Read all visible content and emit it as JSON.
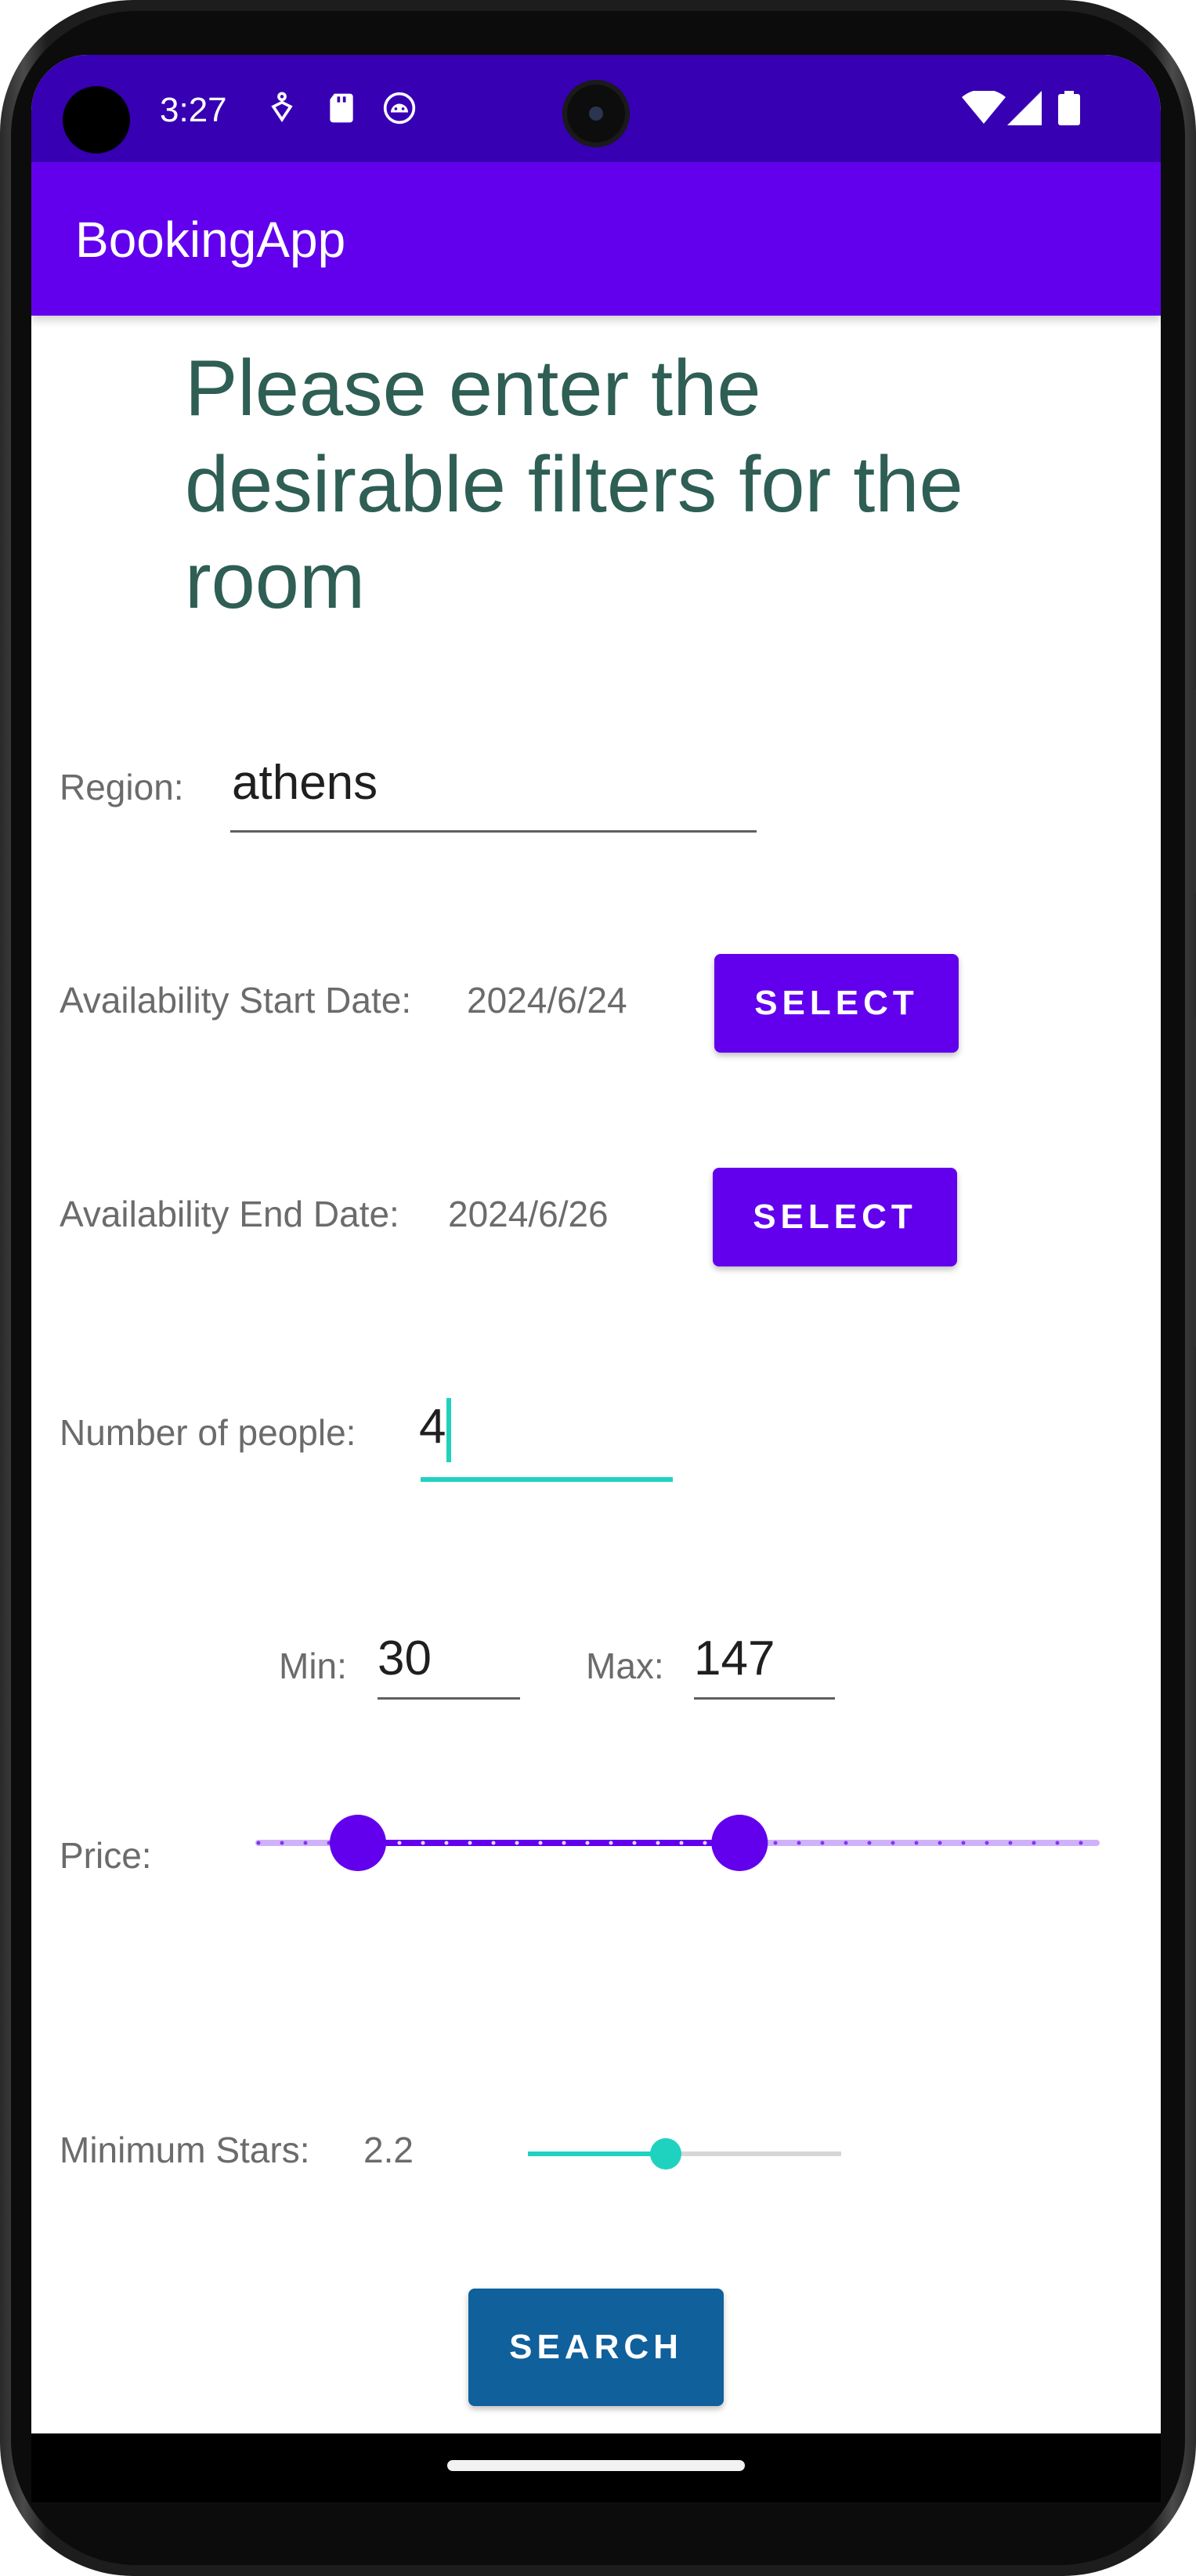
{
  "status_bar": {
    "time": "3:27",
    "left_icons": [
      "accessibility-icon",
      "sd-card-icon",
      "android-debug-icon"
    ],
    "right_icons": [
      "wifi-icon",
      "cell-signal-icon",
      "battery-icon"
    ],
    "background": "#3700b3"
  },
  "app_bar": {
    "title": "BookingApp",
    "background": "#6200ee"
  },
  "form": {
    "heading": "Please enter the desirable filters for the room",
    "region": {
      "label": "Region:",
      "value": "athens"
    },
    "start_date": {
      "label": "Availability Start Date:",
      "value": "2024/6/24",
      "button_label": "SELECT"
    },
    "end_date": {
      "label": "Availability End Date:",
      "value": "2024/6/26",
      "button_label": "SELECT"
    },
    "people": {
      "label": "Number of people:",
      "value": "4"
    },
    "price_min": {
      "label": "Min:",
      "value": "30"
    },
    "price_max": {
      "label": "Max:",
      "value": "147"
    },
    "price": {
      "label": "Price:",
      "range_min_fraction": 0.125,
      "range_max_fraction": 0.59,
      "color": "#6200ee"
    },
    "stars": {
      "label": "Minimum Stars:",
      "value": "2.2",
      "fraction": 0.44,
      "color": "#1fd2c0"
    },
    "search_button_label": "SEARCH"
  },
  "colors": {
    "heading": "#2e5e54",
    "accent": "#1fd2c0",
    "primary": "#6200ee",
    "search_button": "#0f609b"
  }
}
